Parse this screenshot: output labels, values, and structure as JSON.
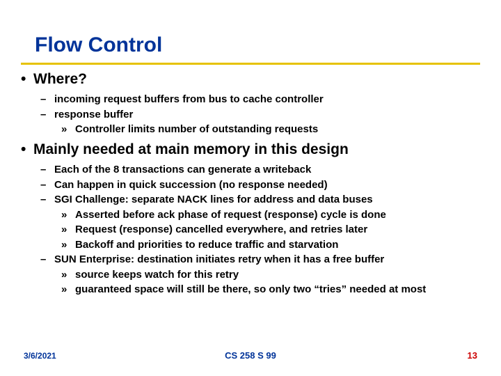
{
  "title": "Flow Control",
  "bullets": {
    "b1": "Where?",
    "b1_1": "incoming request buffers from bus to cache controller",
    "b1_2": "response buffer",
    "b1_2_1": "Controller limits number of outstanding requests",
    "b2": "Mainly needed at main memory in this design",
    "b2_1": "Each of the 8 transactions can generate a writeback",
    "b2_2": "Can happen in quick succession (no response needed)",
    "b2_3": "SGI Challenge: separate NACK lines for address and data buses",
    "b2_3_1": "Asserted before ack phase of request (response) cycle is done",
    "b2_3_2": "Request (response) cancelled everywhere, and retries later",
    "b2_3_3": "Backoff and priorities to reduce traffic and starvation",
    "b2_4": "SUN Enterprise: destination initiates retry when it has a free buffer",
    "b2_4_1": "source keeps watch for this retry",
    "b2_4_2": "guaranteed space will still be there, so only two “tries” needed at most"
  },
  "footer": {
    "date": "3/6/2021",
    "center": "CS 258 S 99",
    "page": "13"
  }
}
